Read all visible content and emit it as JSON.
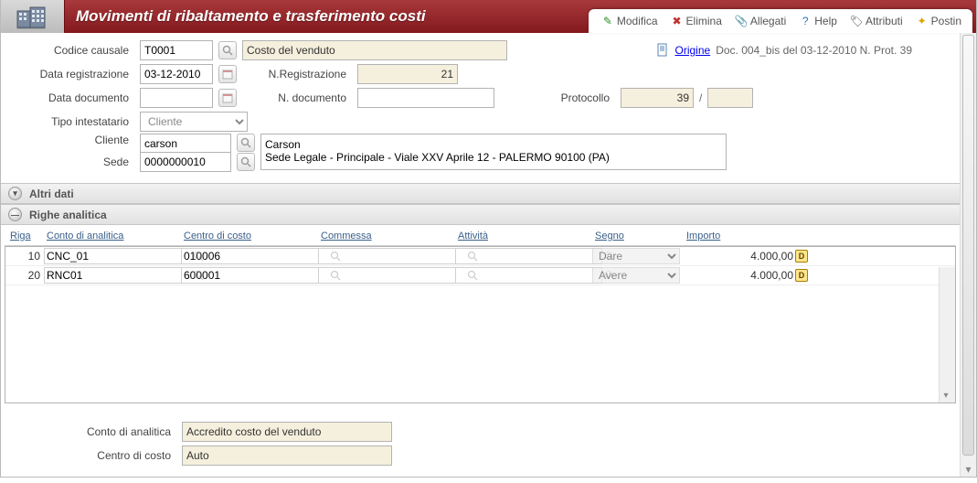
{
  "header": {
    "title": "Movimenti di ribaltamento e trasferimento costi",
    "actions": {
      "modifica": "Modifica",
      "elimina": "Elimina",
      "allegati": "Allegati",
      "help": "Help",
      "attributi": "Attributi",
      "postin": "Postin"
    }
  },
  "subheader": {
    "origine": "Origine",
    "doc_ref": "Doc. 004_bis del 03-12-2010 N. Prot. 39"
  },
  "form": {
    "codice_causale_label": "Codice causale",
    "codice_causale": "T0001",
    "codice_causale_desc": "Costo del venduto",
    "data_registrazione_label": "Data registrazione",
    "data_registrazione": "03-12-2010",
    "n_registrazione_label": "N.Registrazione",
    "n_registrazione": "21",
    "data_documento_label": "Data documento",
    "data_documento": "",
    "n_documento_label": "N. documento",
    "n_documento": "",
    "protocollo_label": "Protocollo",
    "protocollo": "39",
    "tipo_intestatario_label": "Tipo intestatario",
    "tipo_intestatario": "Cliente",
    "cliente_label": "Cliente",
    "cliente": "carson",
    "cliente_desc": "Carson\nSede Legale - Principale - Viale XXV Aprile 12 - PALERMO 90100 (PA)",
    "sede_label": "Sede",
    "sede": "0000000010"
  },
  "bands": {
    "altri_dati": "Altri dati",
    "righe_analitica": "Righe analitica"
  },
  "grid": {
    "columns": {
      "riga": "Riga",
      "conto_analitica": "Conto di analitica",
      "centro_costo": "Centro di costo",
      "commessa": "Commessa",
      "attivita": "Attività",
      "segno": "Segno",
      "importo": "Importo"
    },
    "rows": [
      {
        "riga": "10",
        "conto": "CNC_01",
        "centro": "010006",
        "commessa": "",
        "attivita": "",
        "segno": "Dare",
        "importo": "4.000,00"
      },
      {
        "riga": "20",
        "conto": "RNC01",
        "centro": "600001",
        "commessa": "",
        "attivita": "",
        "segno": "Avere",
        "importo": "4.000,00"
      }
    ]
  },
  "footer": {
    "conto_analitica_label": "Conto di analitica",
    "conto_analitica": "Accredito costo del venduto",
    "centro_costo_label": "Centro di costo",
    "centro_costo": "Auto"
  }
}
